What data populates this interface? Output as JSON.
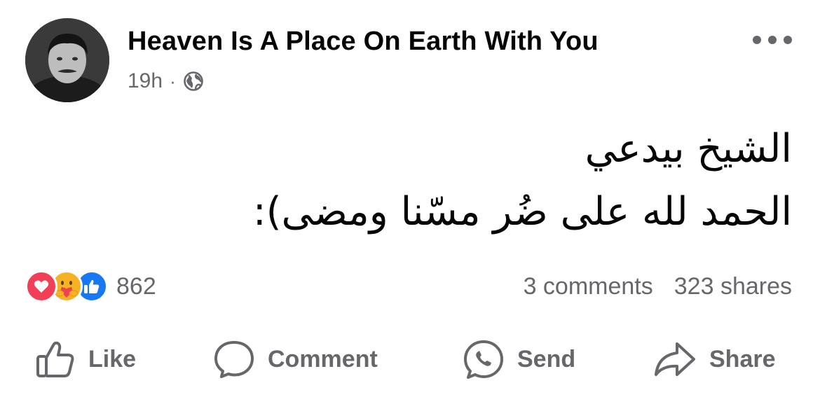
{
  "post": {
    "page_name": "Heaven Is A Place On Earth With You",
    "time": "19h",
    "separator": "·",
    "audience_icon": "globe-icon",
    "more_icon": "more-options-icon",
    "text_lines": [
      "الشيخ بيدعي",
      "الحمد لله على ضُر مسّنا ومضى):"
    ]
  },
  "reactions": {
    "icons": [
      "love-reaction-icon",
      "care-reaction-icon",
      "like-reaction-icon"
    ],
    "count": "862",
    "comments": "3 comments",
    "shares": "323 shares"
  },
  "actions": {
    "like": "Like",
    "comment": "Comment",
    "send": "Send",
    "share": "Share"
  },
  "colors": {
    "text": "#050505",
    "secondary": "#65676b",
    "love": "#f33e58",
    "care": "#f7b125",
    "like": "#1877f2"
  }
}
